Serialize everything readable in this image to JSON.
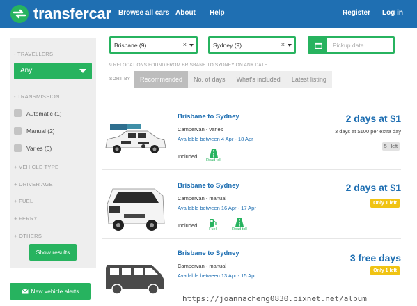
{
  "header": {
    "brand": "transfercar",
    "nav": [
      "Browse all cars",
      "About",
      "Help"
    ],
    "register": "Register",
    "login": "Log in"
  },
  "sidebar": {
    "travellers_heading": "- TRAVELLERS",
    "travellers_value": "Any",
    "transmission_heading": "- TRANSMISSION",
    "transmission_options": [
      "Automatic (1)",
      "Manual (2)",
      "Varies (6)"
    ],
    "collapsed_headings": [
      "+ VEHICLE TYPE",
      "+ DRIVER AGE",
      "+ FUEL",
      "+ FERRY",
      "+ OTHERS"
    ],
    "show_results": "Show results"
  },
  "alerts_button": "New vehicle alerts",
  "filters": {
    "from": "Brisbane (9)",
    "to": "Sydney (9)",
    "clear_glyph": "×",
    "pickup_placeholder": "Pickup date"
  },
  "results_summary": "9 RELOCATIONS FOUND FROM BRISBANE TO SYDNEY ON ANY DATE",
  "sort": {
    "label": "SORT BY",
    "options": [
      "Recommended",
      "No. of days",
      "What's included",
      "Latest listing"
    ],
    "active": "Recommended"
  },
  "listings": [
    {
      "route": "Brisbane to Sydney",
      "vehicle": "Campervan - varies",
      "availability": "Available between 4 Apr - 18 Apr",
      "included_label": "Included:",
      "included": [
        "Road toll"
      ],
      "price": "2 days at $1",
      "extra": "3 days at $100 per extra day",
      "availability_badge": "5+ left"
    },
    {
      "route": "Brisbane to Sydney",
      "vehicle": "Campervan - manual",
      "availability": "Available between 16 Apr - 17 Apr",
      "included_label": "Included:",
      "included": [
        "Fuel",
        "Road toll"
      ],
      "price": "2 days at $1",
      "availability_badge": "Only 1 left"
    },
    {
      "route": "Brisbane to Sydney",
      "vehicle": "Campervan - manual",
      "availability": "Available between 13 Apr - 15 Apr",
      "price": "3 free days",
      "availability_badge": "Only 1 left"
    }
  ],
  "colors": {
    "brand_blue": "#1f6fb2",
    "green": "#27b35f",
    "yellow": "#f0c313"
  },
  "watermark": "https://joannacheng0830.pixnet.net/album"
}
